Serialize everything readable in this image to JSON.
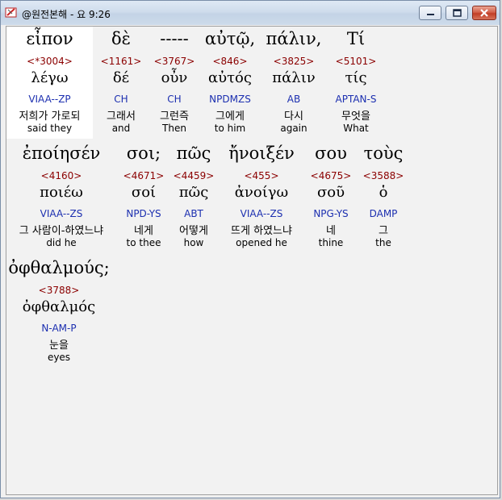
{
  "window": {
    "title": "@원전본해 - 요 9:26",
    "app_icon": "bible-app-icon",
    "controls": {
      "minimize": "minimize-icon",
      "maximize": "maximize-icon",
      "close": "close-icon"
    }
  },
  "words": [
    {
      "greek": "εἶπον",
      "strong": "<*3004>",
      "lemma": "λέγω",
      "morph": "VIAA--ZP",
      "korean": "저희가 가로되",
      "english": "said they"
    },
    {
      "greek": "δὲ",
      "strong": "<1161>",
      "lemma": "δέ",
      "morph": "CH",
      "korean": "그래서",
      "english": "and"
    },
    {
      "greek": "-----",
      "strong": "<3767>",
      "lemma": "οὖν",
      "morph": "CH",
      "korean": "그런즉",
      "english": "Then"
    },
    {
      "greek": "αὐτῷ,",
      "strong": "<846>",
      "lemma": "αὐτός",
      "morph": "NPDMZS",
      "korean": "그에게",
      "english": "to him"
    },
    {
      "greek": "πάλιν,",
      "strong": "<3825>",
      "lemma": "πάλιν",
      "morph": "AB",
      "korean": "다시",
      "english": "again"
    },
    {
      "greek": "Τί",
      "strong": "<5101>",
      "lemma": "τίς",
      "morph": "APTAN-S",
      "korean": "무엇을",
      "english": "What"
    },
    {
      "greek": "ἐποίησέν",
      "strong": "<4160>",
      "lemma": "ποιέω",
      "morph": "VIAA--ZS",
      "korean": "그 사람이-하였느냐",
      "english": "did he"
    },
    {
      "greek": "σοι;",
      "strong": "<4671>",
      "lemma": "σοί",
      "morph": "NPD-YS",
      "korean": "네게",
      "english": "to thee"
    },
    {
      "greek": "πῶς",
      "strong": "<4459>",
      "lemma": "πῶς",
      "morph": "ABT",
      "korean": "어떻게",
      "english": "how"
    },
    {
      "greek": "ἤνοιξέν",
      "strong": "<455>",
      "lemma": "ἀνοίγω",
      "morph": "VIAA--ZS",
      "korean": "뜨게 하였느냐",
      "english": "opened he"
    },
    {
      "greek": "σου",
      "strong": "<4675>",
      "lemma": "σοῦ",
      "morph": "NPG-YS",
      "korean": "네",
      "english": "thine"
    },
    {
      "greek": "τοὺς",
      "strong": "<3588>",
      "lemma": "ὁ",
      "morph": "DAMP",
      "korean": "그",
      "english": "the"
    },
    {
      "greek": "ὀφθαλμούς;",
      "strong": "<3788>",
      "lemma": "ὀφθαλμός",
      "morph": "N-AM-P",
      "korean": "눈을",
      "english": "eyes"
    }
  ]
}
